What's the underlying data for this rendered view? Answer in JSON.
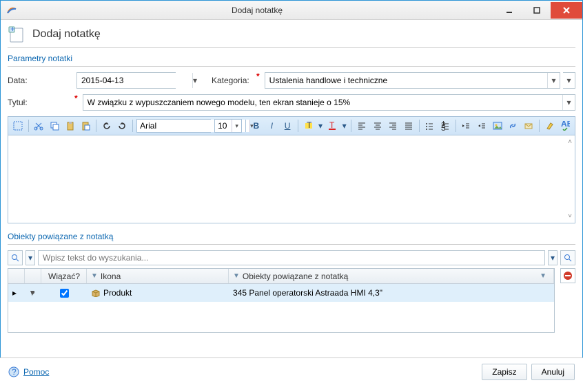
{
  "window": {
    "title": "Dodaj notatkę"
  },
  "header": {
    "title": "Dodaj notatkę"
  },
  "section_params": "Parametry notatki",
  "form": {
    "date_label": "Data:",
    "date_value": "2015-04-13",
    "category_label": "Kategoria:",
    "category_value": "Ustalenia handlowe i techniczne",
    "title_label": "Tytuł:",
    "title_value": "W związku z wypuszczaniem nowego modelu, ten ekran stanieje o 15%"
  },
  "toolbar": {
    "font_name": "Arial",
    "font_size": "10"
  },
  "section_links": "Obiekty powiązane z notatką",
  "search": {
    "placeholder": "Wpisz tekst do wyszukania..."
  },
  "grid": {
    "cols": {
      "bind": "Wiązać?",
      "icon": "Ikona",
      "obj": "Obiekty powiązane z notatką"
    },
    "row": {
      "icon_label": "Produkt",
      "obj_label": "345 Panel operatorski Astraada HMI 4,3\""
    }
  },
  "footer": {
    "help": "Pomoc",
    "save": "Zapisz",
    "cancel": "Anuluj"
  }
}
